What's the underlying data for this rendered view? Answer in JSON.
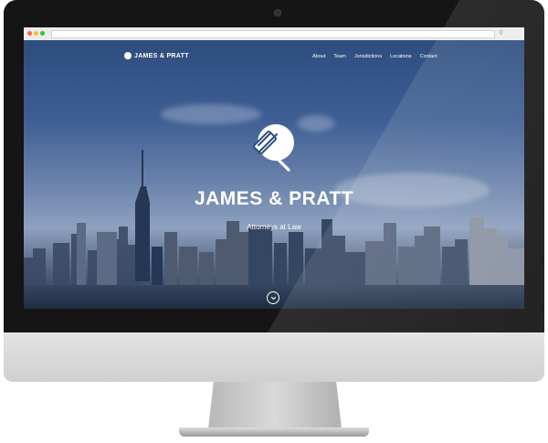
{
  "site": {
    "brand_name": "JAMES & PRATT",
    "nav": [
      {
        "label": "About"
      },
      {
        "label": "Team"
      },
      {
        "label": "Jurisdictions"
      },
      {
        "label": "Locations"
      },
      {
        "label": "Contact"
      }
    ],
    "hero": {
      "title": "JAMES & PRATT",
      "subtitle": "Attorneys at Law"
    }
  },
  "icons": {
    "hero_logo": "gavel-icon",
    "brand_logo": "gavel-logo-icon",
    "scroll": "chevron-down-icon"
  },
  "colors": {
    "screen_bezel": "#151515",
    "chin": "#d9d9d9",
    "hero_text": "#ffffff"
  }
}
